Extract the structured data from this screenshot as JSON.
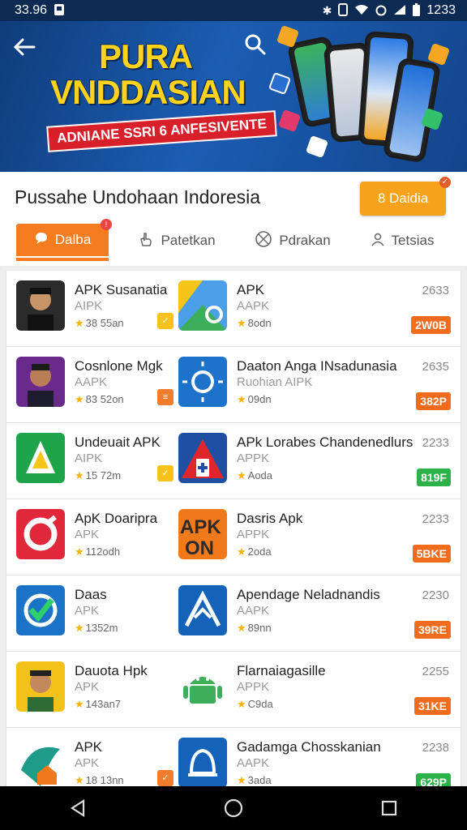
{
  "status_bar": {
    "time": "33.96",
    "right_time": "1233"
  },
  "banner": {
    "title_line1": "PURA",
    "title_line2": "VNDDASIAN",
    "subtitle": "ADNIANE SSRI 6 ANFESIVENTE"
  },
  "header": {
    "title": "Pussahe Undohaan Indoresia",
    "action_label": "8 Daidia"
  },
  "tabs": [
    {
      "label": "Dalba",
      "icon": "chat-bubble-icon",
      "active": true
    },
    {
      "label": "Patetkan",
      "icon": "hand-icon",
      "active": false
    },
    {
      "label": "Pdrakan",
      "icon": "no-entry-icon",
      "active": false
    },
    {
      "label": "Tetsias",
      "icon": "person-icon",
      "active": false
    }
  ],
  "rows": [
    {
      "left": {
        "name": "APK Susanatia",
        "sub": "AIPK",
        "rating": "38 55an",
        "tag_color": "#f8c21c"
      },
      "right": {
        "name": "APK",
        "sub": "AAPK",
        "rating": "8odn",
        "num": "2633",
        "badge": "2W0B",
        "badge_color": "#ef6c1c"
      }
    },
    {
      "left": {
        "name": "Cosnlone Mgk",
        "sub": "AAPK",
        "rating": "83 52on",
        "tag_color": "#ef7d2c"
      },
      "right": {
        "name": "Daaton Anga INsadunasia",
        "sub": "Ruohian AIPK",
        "rating": "09dn",
        "num": "2635",
        "badge": "382P",
        "badge_color": "#ef6c1c"
      }
    },
    {
      "left": {
        "name": "Undeuait APK",
        "sub": "AIPK",
        "rating": "15 72m",
        "tag_color": "#f8c21c"
      },
      "right": {
        "name": "APk Lorabes Chandenedlurs",
        "sub": "APPK",
        "rating": "Aoda",
        "num": "2233",
        "badge": "819F",
        "badge_color": "#2db24a"
      }
    },
    {
      "left": {
        "name": "ApK Doaripra",
        "sub": "APK",
        "rating": "112odh",
        "tag_color": ""
      },
      "right": {
        "name": "Dasris Apk",
        "sub": "APPK",
        "rating": "2oda",
        "num": "2233",
        "badge": "5BKE",
        "badge_color": "#ef6c1c"
      }
    },
    {
      "left": {
        "name": "Daas",
        "sub": "APK",
        "rating": "1352m",
        "tag_color": ""
      },
      "right": {
        "name": "Apendage Neladnandis",
        "sub": "AAPK",
        "rating": "89nn",
        "num": "2230",
        "badge": "39RE",
        "badge_color": "#ef6c1c"
      }
    },
    {
      "left": {
        "name": "Dauota Hpk",
        "sub": "APK",
        "rating": "143an7",
        "tag_color": ""
      },
      "right": {
        "name": "Flarnaiagasille",
        "sub": "APPK",
        "rating": "C9da",
        "num": "2255",
        "badge": "31KE",
        "badge_color": "#ef6c1c"
      }
    },
    {
      "left": {
        "name": "APK",
        "sub": "APK",
        "rating": "18 13nn",
        "tag_color": "#ef7d2c"
      },
      "right": {
        "name": "Gadamga Chosskanian",
        "sub": "AAPK",
        "rating": "3ada",
        "num": "2238",
        "badge": "629P",
        "badge_color": "#2db24a"
      }
    }
  ],
  "colors": {
    "accent": "#f57c1f",
    "banner_blue": "#1b5db3",
    "title_yellow": "#ffd21e"
  }
}
